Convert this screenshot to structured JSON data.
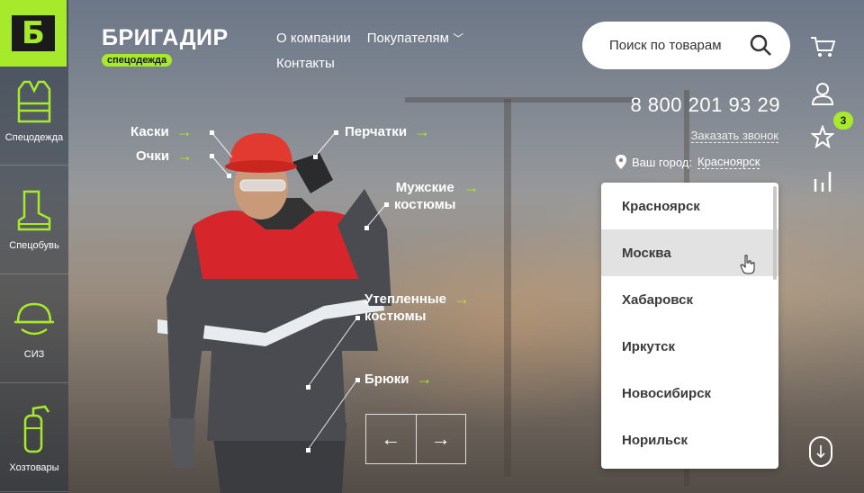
{
  "brand": {
    "name": "БРИГАДИР",
    "tagline": "спецодежда",
    "logo_letter": "Б"
  },
  "nav": {
    "about": "О компании",
    "buyers": "Покупателям",
    "contacts": "Контакты"
  },
  "search": {
    "placeholder": "Поиск по товарам"
  },
  "sidebar": {
    "items": [
      {
        "label": "Спецодежда",
        "icon": "vest-icon"
      },
      {
        "label": "Спецобувь",
        "icon": "boot-icon"
      },
      {
        "label": "СИЗ",
        "icon": "helmet-icon"
      },
      {
        "label": "Хозтовары",
        "icon": "extinguisher-icon"
      }
    ]
  },
  "contacts": {
    "phone": "8 800 201 93 29",
    "callback": "Заказать звонок",
    "city_prefix": "Ваш город:",
    "city": "Красноярск"
  },
  "favorites_count": "3",
  "city_dropdown": {
    "options": [
      "Красноярск",
      "Москва",
      "Хабаровск",
      "Иркутск",
      "Новосибирск",
      "Норильск"
    ],
    "hovered": "Москва"
  },
  "hero_labels": {
    "helmets": "Каски",
    "glasses": "Очки",
    "gloves": "Перчатки",
    "mens_suits_1": "Мужские",
    "mens_suits_2": "костюмы",
    "insulated_1": "Утепленные",
    "insulated_2": "костюмы",
    "trousers": "Брюки"
  },
  "slider": {
    "prev": "←",
    "next": "→"
  },
  "colors": {
    "accent": "#a6ea2b",
    "jacket_red": "#d7262b",
    "jacket_gray": "#4a4b50"
  }
}
